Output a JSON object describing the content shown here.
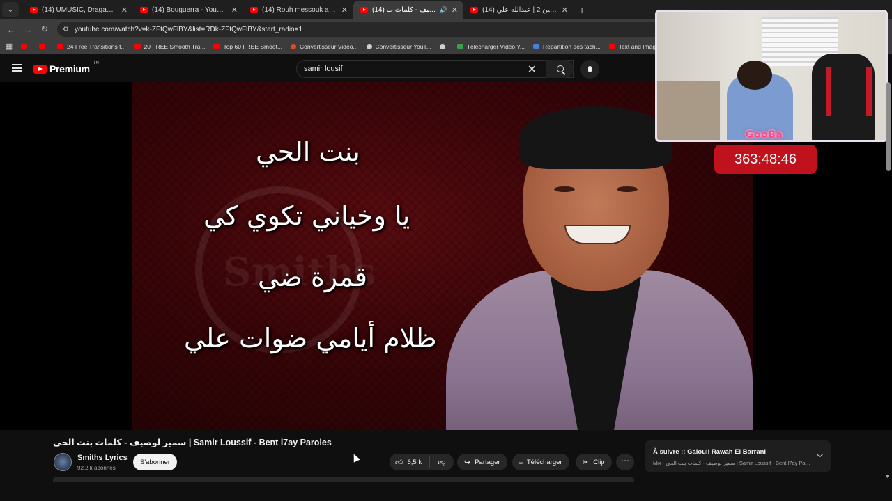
{
  "browser": {
    "tabs": [
      {
        "title": "(14) UMUSIC, Draganov - 3dab",
        "active": false
      },
      {
        "title": "(14) Bouguerra - YouTube",
        "active": false
      },
      {
        "title": "(14) Rouh messouk amar - You",
        "active": false
      },
      {
        "title": "(14) سمير لوصيف - كلمات ب",
        "active": true,
        "audio": true
      },
      {
        "title": "(14) تحدي الثلاثين 2 | عبدالله علي",
        "active": false
      }
    ],
    "url": "youtube.com/watch?v=k-ZFtQwFlBY&list=RDk-ZFtQwFlBY&start_radio=1",
    "bookmarks": [
      {
        "label": "",
        "icon": "youtube"
      },
      {
        "label": "",
        "icon": "youtube"
      },
      {
        "label": "24 Free Transitions f...",
        "icon": "youtube"
      },
      {
        "label": "20 FREE Smooth Tra...",
        "icon": "youtube"
      },
      {
        "label": "Top 60 FREE Smoot...",
        "icon": "youtube"
      },
      {
        "label": "Convertisseur Video...",
        "icon": "orange"
      },
      {
        "label": "Convertisseur YouT...",
        "icon": "gear"
      },
      {
        "label": "",
        "icon": "globe"
      },
      {
        "label": "Télécharger Vidéo Y...",
        "icon": "green"
      },
      {
        "label": "Repartition des tach...",
        "icon": "blue"
      },
      {
        "label": "Text and Image ani...",
        "icon": "youtube"
      }
    ]
  },
  "youtube": {
    "logo_text": "Premium",
    "logo_sup": "TN",
    "search_query": "samir lousif"
  },
  "video": {
    "lyrics": [
      "بنت الحي",
      "يا وخياني تكوي كي",
      "قمرة ضي",
      "ظلام أيامي ضوات علي"
    ],
    "watermark": "Smiths"
  },
  "overlay": {
    "streamer_name": "GooBa",
    "timer": "363:48:46"
  },
  "info": {
    "title": "سمير لوصيف - كلمات بنت الحي | Samir Loussif - Bent l7ay Paroles",
    "channel_name": "Smiths Lyrics",
    "subscribers": "92,2 k abonnés",
    "subscribe_label": "S'abonner",
    "likes": "6,5 k",
    "share_label": "Partager",
    "download_label": "Télécharger",
    "clip_label": "Clip",
    "up_next_title": "À suivre :: Galouli Rawah El Barrani",
    "up_next_sub": "Mix - سمير لوصيف - كلمات بنت الحي | Samir Loussif - Bent l7ay Paro..."
  }
}
